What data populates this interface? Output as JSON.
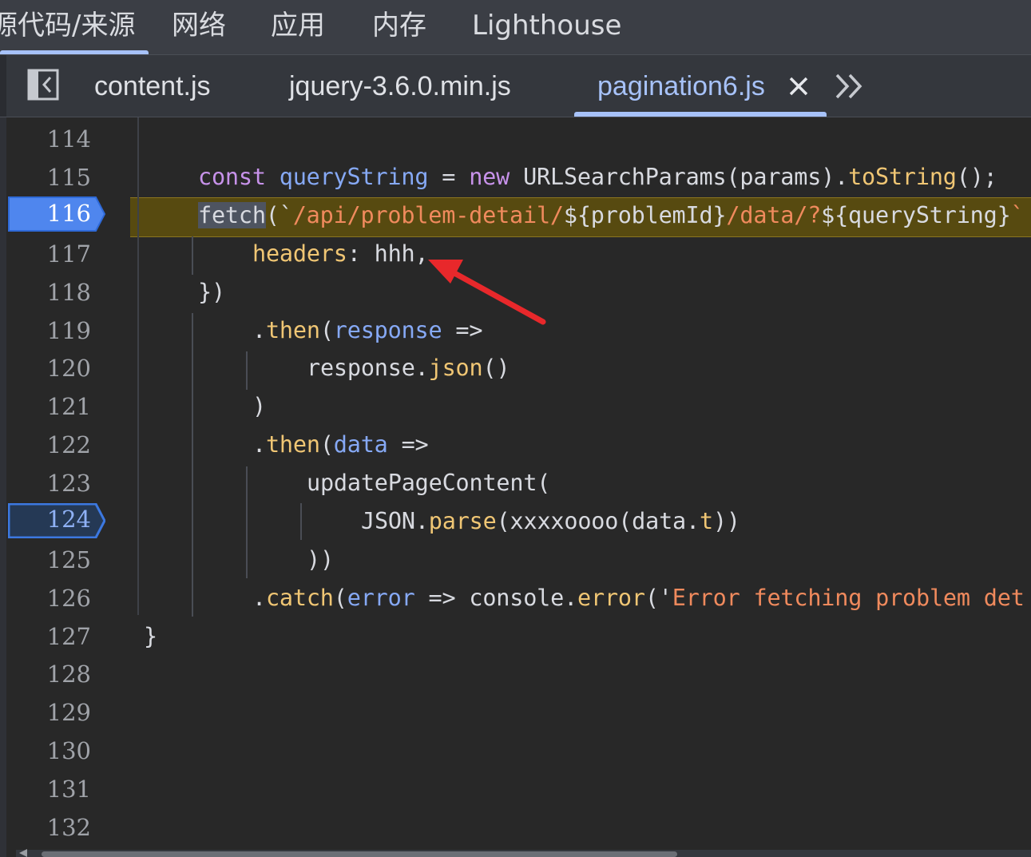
{
  "panel_tabs": [
    "源代码/来源",
    "网络",
    "应用",
    "内存",
    "Lighthouse"
  ],
  "file_tabs": [
    "content.js",
    "jquery-3.6.0.min.js",
    "pagination6.js"
  ],
  "active_file": "pagination6.js",
  "icons": {
    "sidebar_toggle": "sidebar-toggle-icon",
    "close": "close-icon",
    "more": "chevron-double-right-icon",
    "annotation": "red-arrow"
  },
  "colors": {
    "accent": "#a7c2f9",
    "breakpoint": "#5b8def",
    "execution_line": "#574a10",
    "annotation_arrow": "#e8282b"
  },
  "editor": {
    "line_numbers": [
      "114",
      "115",
      "116",
      "117",
      "118",
      "119",
      "120",
      "121",
      "122",
      "123",
      "124",
      "125",
      "126",
      "127",
      "128",
      "129",
      "130",
      "131",
      "132"
    ],
    "breakpoints": [
      "116",
      "124"
    ],
    "current_line": "116",
    "code": {
      "l115": {
        "a": "const",
        "b": "queryString",
        "c": " = ",
        "d": "new",
        "e": "URLSearchParams(params).",
        "f": "toString",
        "g": "();"
      },
      "l116": {
        "a": "fetch",
        "b": "(`",
        "c": "/api/problem-detail/",
        "d": "${problemId}",
        "e": "/data/?",
        "f": "${queryString}",
        "g": "`"
      },
      "l117": {
        "a": "headers",
        "b": ": hhh,"
      },
      "l118": {
        "a": "})"
      },
      "l119": {
        "a": ".",
        "b": "then",
        "c": "(",
        "d": "response",
        "e": " =>"
      },
      "l120": {
        "a": "response.",
        "b": "json",
        "c": "()"
      },
      "l121": {
        "a": ")"
      },
      "l122": {
        "a": ".",
        "b": "then",
        "c": "(",
        "d": "data",
        "e": " =>"
      },
      "l123": {
        "a": "updatePageContent("
      },
      "l124": {
        "a": "JSON.",
        "b": "parse",
        "c": "(xxxxoooo(data.",
        "d": "t",
        "e": "))"
      },
      "l125": {
        "a": "))"
      },
      "l126": {
        "a": ".",
        "b": "catch",
        "c": "(",
        "d": "error",
        "e": " => console.",
        "f": "error",
        "g": "('",
        "h": "Error fetching problem det"
      },
      "l127": {
        "a": "}"
      }
    }
  }
}
